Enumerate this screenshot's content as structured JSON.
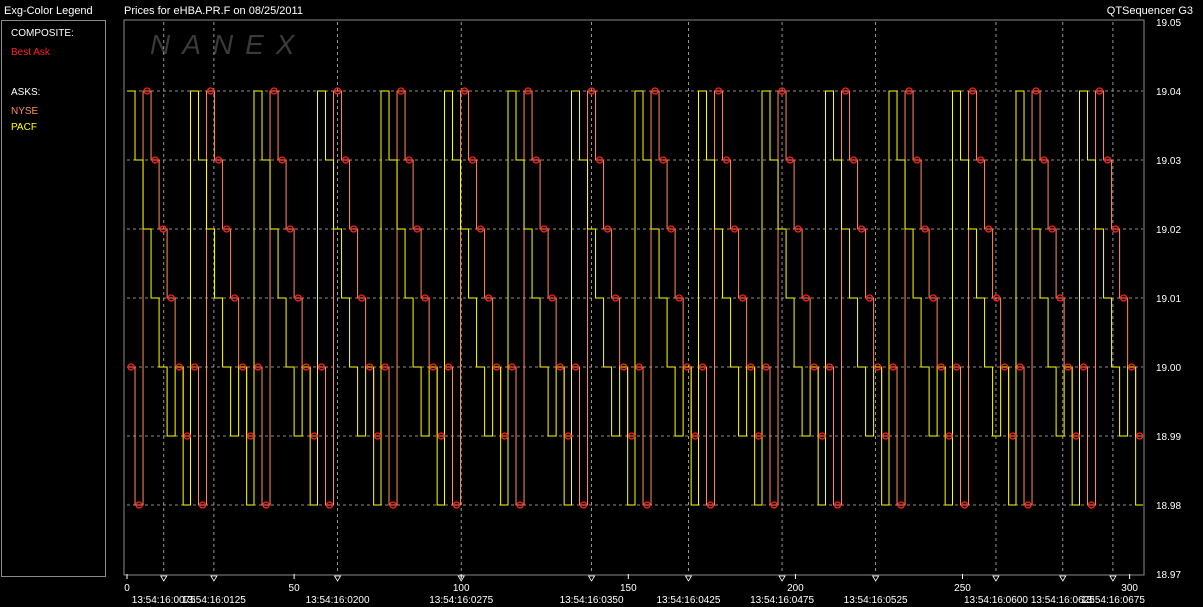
{
  "header": {
    "legend_title": "Exg-Color Legend",
    "chart_title": "Prices for  eHBA.PR.F  on  08/25/2011",
    "app_name": "QTSequencer G3"
  },
  "legend": {
    "composite_heading": "COMPOSITE:",
    "composite_items": [
      {
        "label": "Best Ask",
        "color": "#ff2020"
      }
    ],
    "asks_heading": "ASKS:",
    "ask_items": [
      {
        "label": "NYSE",
        "color": "#ff8c5a"
      },
      {
        "label": "PACF",
        "color": "#ffff00"
      }
    ]
  },
  "watermark": "NANEX",
  "colors": {
    "background": "#000000",
    "panel_border": "#8a8a8a",
    "grid": "#bbbbbb",
    "best_ask_marker": "#ff2020",
    "nyse": "#ff8c5a",
    "pacf": "#ffff00"
  },
  "chart_data": {
    "type": "line",
    "title": "Prices for  eHBA.PR.F  on  08/25/2011",
    "xlabel": "",
    "ylabel": "",
    "ylim": [
      18.97,
      19.05
    ],
    "xlim": [
      0,
      304
    ],
    "y_ticks": [
      "18.97",
      "18.98",
      "18.99",
      "19.00",
      "19.01",
      "19.02",
      "19.03",
      "19.04",
      "19.05"
    ],
    "x_ticks": [
      0,
      50,
      100,
      150,
      200,
      250,
      300
    ],
    "time_labels": [
      {
        "x": 11,
        "label": "13:54:16:0075"
      },
      {
        "x": 26,
        "label": "13:54:16:0125"
      },
      {
        "x": 63,
        "label": "13:54:16:0200"
      },
      {
        "x": 100,
        "label": "13:54:16:0275"
      },
      {
        "x": 139,
        "label": "13:54:16:0350"
      },
      {
        "x": 168,
        "label": "13:54:16:0425"
      },
      {
        "x": 196,
        "label": "13:54:16:0475"
      },
      {
        "x": 224,
        "label": "13:54:16:0525"
      },
      {
        "x": 260,
        "label": "13:54:16:0600"
      },
      {
        "x": 280,
        "label": "13:54:16:0625"
      },
      {
        "x": 295,
        "label": "13:54:16:0675"
      }
    ],
    "grid": true,
    "cycle": {
      "pattern": [
        19.0,
        18.98,
        19.04,
        19.03,
        19.02,
        19.01,
        19.0,
        18.99
      ],
      "step": 2.4,
      "cycle_starts": [
        0,
        19,
        38,
        57,
        76,
        95,
        114,
        133,
        152,
        171,
        190,
        209,
        228,
        247,
        266,
        285
      ]
    },
    "series": [
      {
        "name": "NYSE",
        "color": "#ff8c5a",
        "cycle_phase": 0
      },
      {
        "name": "PACF",
        "color": "#ffff00",
        "cycle_phase": 2
      }
    ],
    "best_ask_markers": {
      "color": "#ff2020",
      "levels": [
        19.04,
        19.03,
        19.02,
        19.01,
        19.0,
        18.99,
        18.98
      ]
    }
  }
}
